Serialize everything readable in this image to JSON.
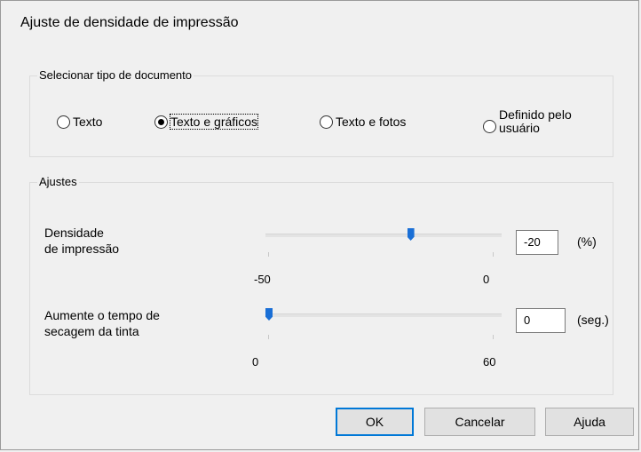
{
  "dialog": {
    "title": "Ajuste de densidade de impressão"
  },
  "document_type": {
    "label": "Selecionar tipo de documento",
    "options": [
      {
        "label": "Texto",
        "selected": false
      },
      {
        "label": "Texto e gráficos",
        "selected": true
      },
      {
        "label": "Texto e fotos",
        "selected": false
      },
      {
        "label": "Definido pelo\nusuário",
        "selected": false
      }
    ]
  },
  "settings": {
    "label": "Ajustes",
    "density": {
      "label": "Densidade\nde impressão",
      "value": "-20",
      "unit": "(%)",
      "min_label": "-50",
      "max_label": "0",
      "level_percent": 60
    },
    "drying": {
      "label": "Aumente o tempo de\nsecagem da tinta",
      "value": "0",
      "unit": "(seg.)",
      "min_label": "0",
      "max_label": "60",
      "level_percent": 0
    }
  },
  "buttons": {
    "ok": "OK",
    "cancel": "Cancelar",
    "help": "Ajuda"
  },
  "colors": {
    "slider_thumb": "#1a6fd6",
    "default_button_border": "#0078d7"
  }
}
